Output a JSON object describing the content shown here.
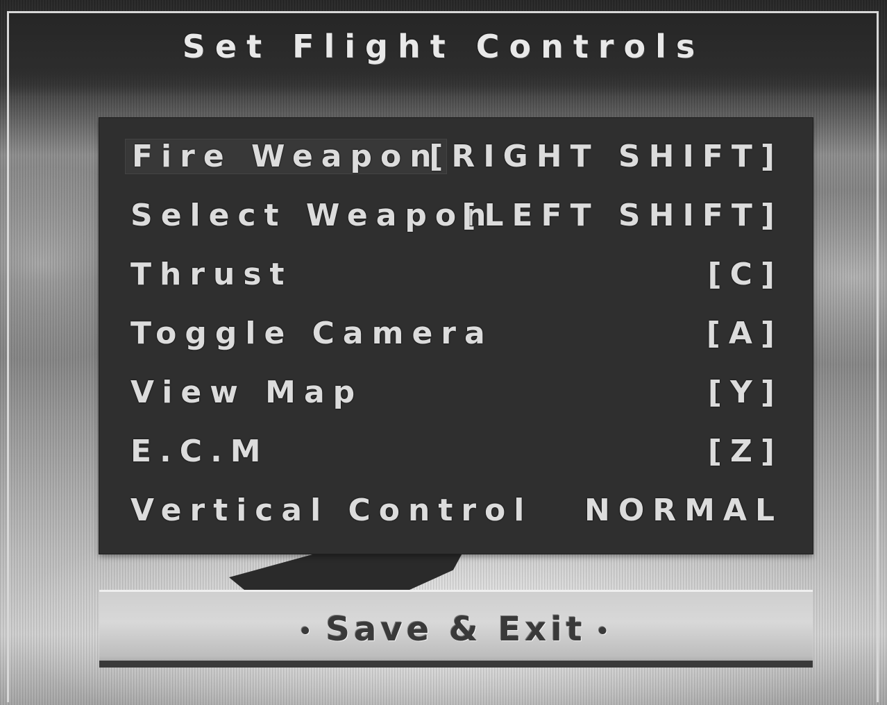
{
  "title": "Set Flight Controls",
  "controls": [
    {
      "action": "Fire Weapon",
      "key": "[RIGHT SHIFT]"
    },
    {
      "action": "Select Weapon",
      "key": "[LEFT SHIFT]"
    },
    {
      "action": "Thrust",
      "key": "[C]"
    },
    {
      "action": "Toggle Camera",
      "key": "[A]"
    },
    {
      "action": "View Map",
      "key": "[Y]"
    },
    {
      "action": "E.C.M",
      "key": "[Z]"
    },
    {
      "action": "Vertical Control",
      "key": "NORMAL"
    }
  ],
  "selected_index": 0,
  "save_exit": {
    "label": "Save & Exit",
    "bullet_glyph": "•"
  },
  "colors": {
    "panel": "#2f2f2f",
    "text": "#dcdcdc",
    "button": "#d0d0d0"
  }
}
